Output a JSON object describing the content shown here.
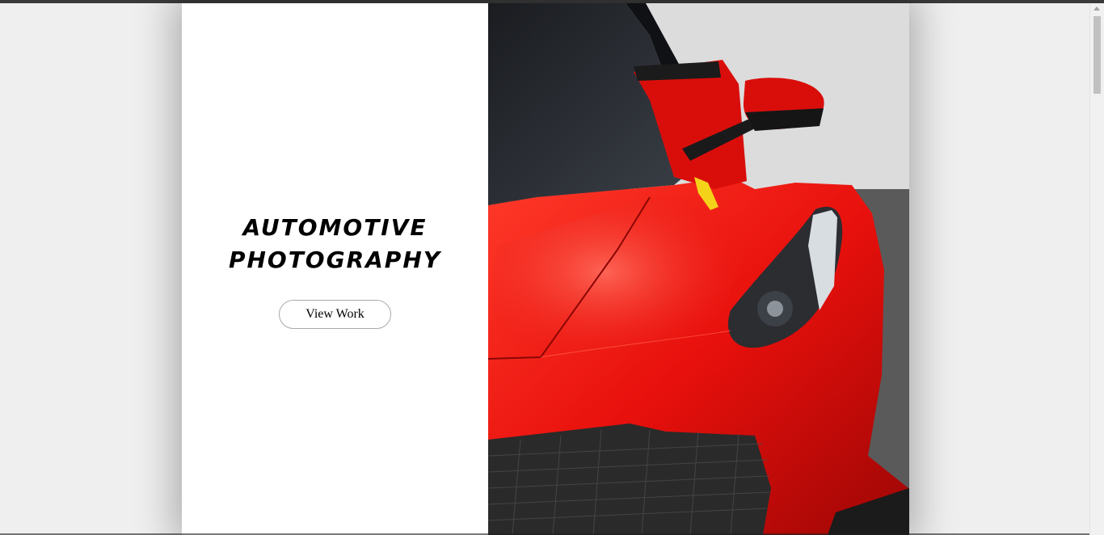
{
  "hero": {
    "title_line1": "AUTOMOTIVE",
    "title_line2": "PHOTOGRAPHY",
    "button_label": "View Work"
  },
  "image": {
    "subject": "red sports car front",
    "icon": "car-photo"
  },
  "colors": {
    "car_red": "#e8100c",
    "page_bg": "#efefef",
    "card_bg": "#ffffff"
  }
}
